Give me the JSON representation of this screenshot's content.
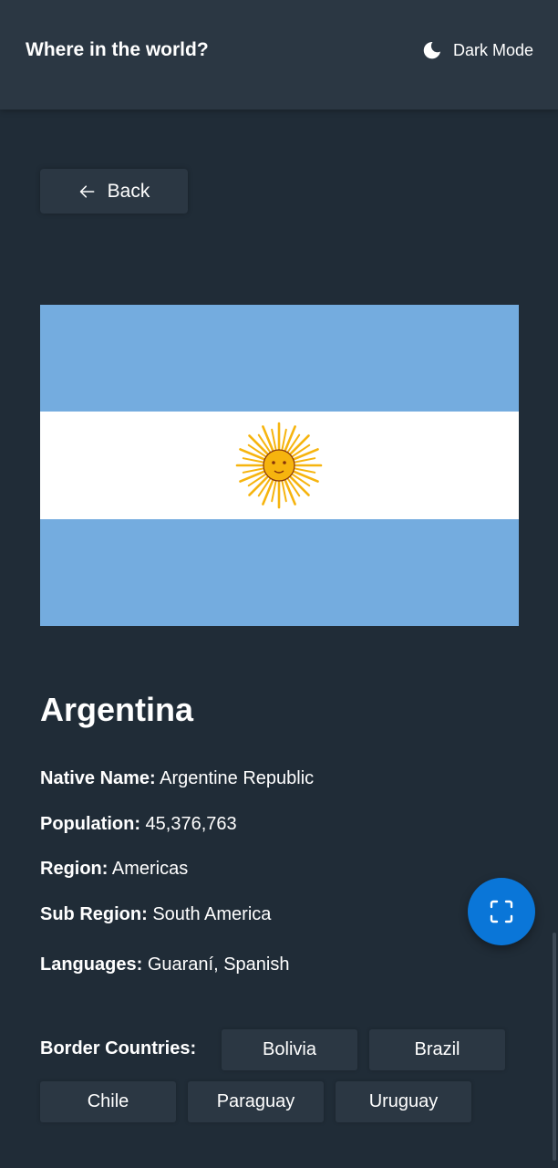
{
  "header": {
    "title": "Where in the world?",
    "mode_label": "Dark Mode",
    "mode_icon": "moon-icon"
  },
  "back": {
    "label": "Back",
    "icon": "arrow-left-icon"
  },
  "flag": {
    "icon": "argentina-flag",
    "colors": {
      "blue": "#74acdf",
      "white": "#ffffff",
      "sun": "#f6b40e",
      "sun_edge": "#85340a"
    }
  },
  "country": {
    "name": "Argentina",
    "details": [
      {
        "key": "native_name",
        "label": "Native Name:",
        "value": "Argentine Republic"
      },
      {
        "key": "population",
        "label": "Population:",
        "value": "45,376,763"
      },
      {
        "key": "region",
        "label": "Region:",
        "value": "Americas"
      },
      {
        "key": "sub_region",
        "label": "Sub Region:",
        "value": "South America"
      },
      {
        "key": "languages",
        "label": "Languages:",
        "value": "Guaraní, Spanish"
      }
    ]
  },
  "border": {
    "label": "Border Countries:",
    "countries": [
      "Bolivia",
      "Brazil",
      "Chile",
      "Paraguay",
      "Uruguay"
    ]
  },
  "fab": {
    "icon": "screenshot-capture-icon",
    "color": "#0a76d8"
  },
  "colors": {
    "background": "#202c37",
    "element": "#2b3743",
    "text": "#ffffff"
  }
}
